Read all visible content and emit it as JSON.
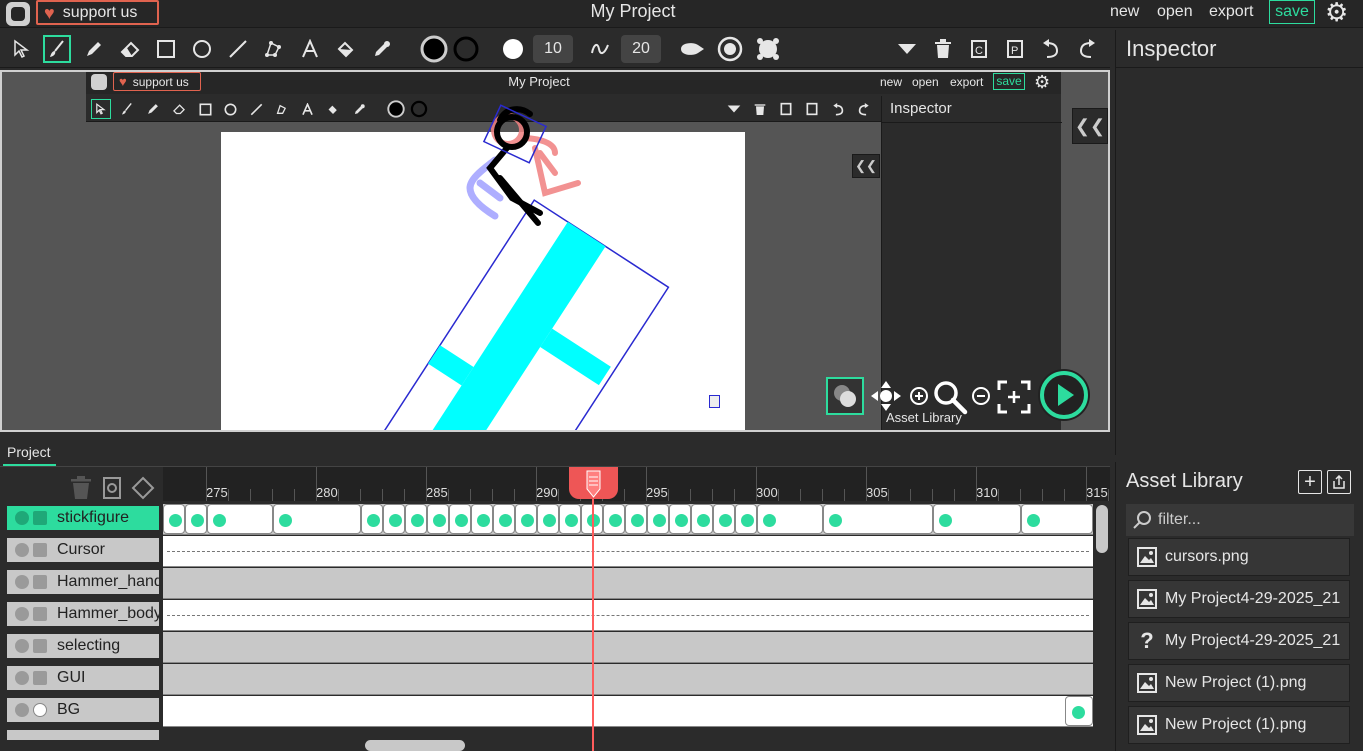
{
  "header": {
    "support_label": "support us",
    "title": "My Project",
    "menu": {
      "new": "new",
      "open": "open",
      "export": "export",
      "save": "save"
    }
  },
  "toolbar": {
    "stroke_size": "10",
    "smoothing": "20",
    "icons": [
      "select-transform",
      "brush",
      "pencil",
      "eraser",
      "rectangle",
      "ellipse",
      "line",
      "polygon",
      "text",
      "paint-bucket",
      "eyedropper"
    ]
  },
  "inspector": {
    "title": "Inspector"
  },
  "assets": {
    "title": "Asset Library",
    "filter_placeholder": "filter...",
    "items": [
      {
        "name": "cursors.png",
        "icon": "image-icon"
      },
      {
        "name": "My Project4-29-2025_21",
        "icon": "image-icon"
      },
      {
        "name": "My Project4-29-2025_21",
        "icon": "question-icon"
      },
      {
        "name": "New Project (1).png",
        "icon": "image-icon"
      },
      {
        "name": "New Project (1).png",
        "icon": "image-icon"
      }
    ]
  },
  "inner": {
    "support_label": "support us",
    "title": "My Project",
    "menu": {
      "new": "new",
      "open": "open",
      "export": "export",
      "save": "save"
    },
    "inspector_title": "Inspector",
    "asset_label": "Asset Library"
  },
  "timeline": {
    "tab": "Project",
    "ruler": [
      "275",
      "280",
      "285",
      "290",
      "295",
      "300",
      "305",
      "310",
      "315"
    ],
    "layers": [
      {
        "name": "stickfigure",
        "active": true
      },
      {
        "name": "Cursor",
        "active": false
      },
      {
        "name": "Hammer_handle",
        "active": false
      },
      {
        "name": "Hammer_body",
        "active": false
      },
      {
        "name": "selecting",
        "active": false
      },
      {
        "name": "GUI",
        "active": false
      },
      {
        "name": "BG",
        "active": false
      }
    ]
  },
  "colors": {
    "accent": "#2ddc9e",
    "support": "#e0634f",
    "playhead": "#ff5c5c",
    "selection": "#2a2ad0",
    "shape_fill": "#00ffff"
  }
}
